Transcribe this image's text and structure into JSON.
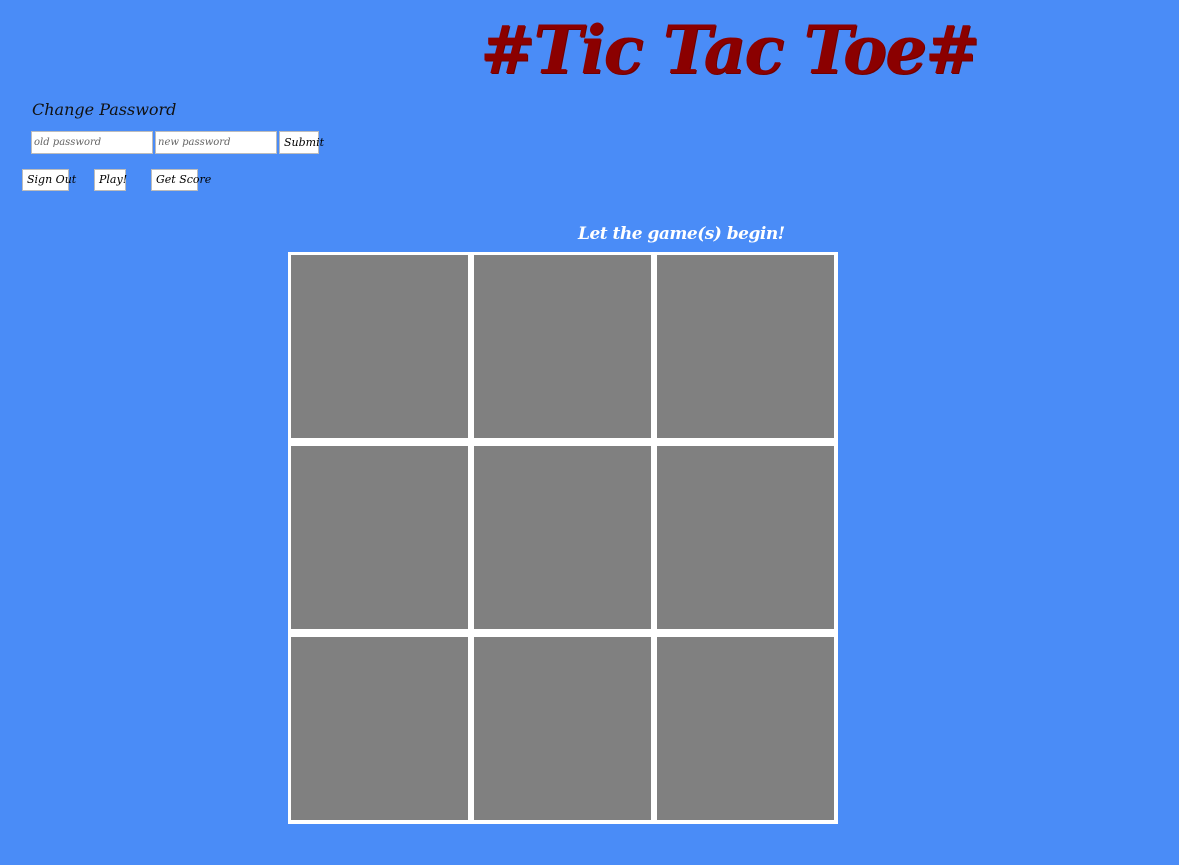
{
  "header": {
    "title": "#Tic Tac Toe#"
  },
  "change_password": {
    "heading": "Change Password",
    "old_placeholder": "old password",
    "old_value": "",
    "new_placeholder": "new password",
    "new_value": "",
    "submit_label": "Submit"
  },
  "nav": {
    "sign_out_label": "Sign Out",
    "play_label": "Play!",
    "get_score_label": "Get Score"
  },
  "game": {
    "message": "Let the game(s) begin!",
    "cells": [
      "",
      "",
      "",
      "",
      "",
      "",
      "",
      "",
      ""
    ]
  },
  "colors": {
    "background": "#4a8cf7",
    "title": "#8b0000",
    "cell": "#808080",
    "board_border": "#ffffff"
  }
}
